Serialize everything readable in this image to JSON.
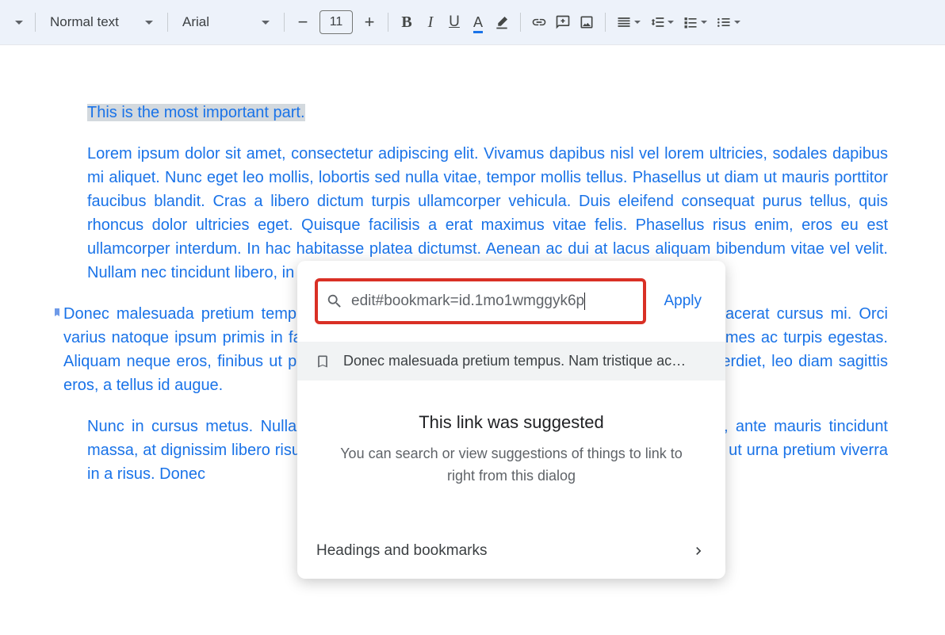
{
  "toolbar": {
    "style_label": "Normal text",
    "font_label": "Arial",
    "font_size": "11"
  },
  "document": {
    "title_line": "This is the most important part.",
    "para1": "Lorem ipsum dolor sit amet, consectetur adipiscing elit. Vivamus dapibus nisl vel lorem ultricies, sodales dapibus mi aliquet. Nunc eget leo mollis, lobortis sed nulla vitae, tempor mollis tellus. Phasellus ut diam ut mauris porttitor faucibus blandit. Cras a libero dictum turpis ullamcorper vehicula. Duis eleifend consequat purus tellus, quis rhoncus dolor ultricies eget. Quisque facilisis a erat maximus vitae felis. Phasellus risus enim, eros eu est ullamcorper interdum. In hac habitasse platea dictumst. Aenean ac dui at lacus aliquam bibendum vitae vel velit. Nullam nec tincidunt libero, in fringilla libero.",
    "para2": "Donec malesuada pretium tempus. Nam tristique ac augue libero, tempus sed velit vel, placerat cursus mi. Orci varius natoque ipsum primis in faucibus. Pellentesque habitant morbi tristique senectus et fames ac turpis egestas. Aliquam neque eros, finibus ut pulvinar sit amet. In fermentum, risus quis condimentum imperdiet, leo diam sagittis eros, a tellus id augue.",
    "para3": "Nunc in cursus metus. Nulla facilisi. Mauris ornare arcu risus, in quis aliquam ultricies, ante mauris tincidunt massa, at dignissim libero risus ut nisi. In fermentum eros, et tempus augue. Donec a ante ut urna pretium viverra in a risus. Donec"
  },
  "link_dialog": {
    "input_value": "edit#bookmark=id.1mo1wmggyk6p",
    "apply_label": "Apply",
    "suggestion_text": "Donec malesuada pretium tempus. Nam tristique ac…",
    "hint_title": "This link was suggested",
    "hint_body": "You can search or view suggestions of things to link to right from this dialog",
    "bottom_label": "Headings and bookmarks"
  }
}
